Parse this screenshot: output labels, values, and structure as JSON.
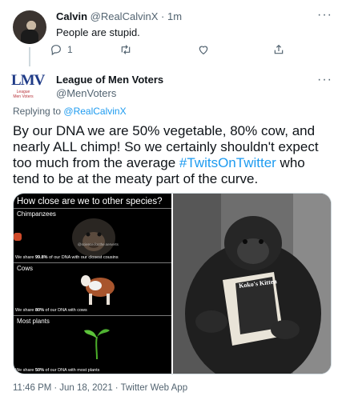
{
  "reply_tweet": {
    "name": "Calvin",
    "handle": "@RealCalvinX",
    "separator": "·",
    "time": "1m",
    "text": "People are stupid.",
    "more": "···",
    "reply_count": "1",
    "retweet_count": "",
    "like_count": ""
  },
  "main_tweet": {
    "avatar_logo": "LMV",
    "avatar_subtitle_line1": "League",
    "avatar_subtitle_line2": "Men Voters",
    "name": "League of Men Voters",
    "handle": "@MenVoters",
    "more": "···",
    "replying_prefix": "Replying to",
    "replying_handle": "@RealCalvinX",
    "text_before": "By our DNA we are 50% vegetable, 80% cow, and nearly ALL chimp!  So we certainly shouldn't expect too much from the average ",
    "hashtag": "#TwitsOnTwitter",
    "text_after": " who tend to be at the meaty part of the curve.",
    "infographic": {
      "title": "How close are we to other species?",
      "panels": [
        {
          "label": "Chimpanzees",
          "caption_pre": "We share ",
          "caption_bold": "99.8%",
          "caption_post": " of our DNA with our closest cousins",
          "watermark": "@science.for.the.serverts"
        },
        {
          "label": "Cows",
          "caption_pre": "We share ",
          "caption_bold": "80%",
          "caption_post": " of our DNA with cows"
        },
        {
          "label": "Most plants",
          "caption_pre": "We share ",
          "caption_bold": "50%",
          "caption_post": " of our DNA with most plants"
        }
      ]
    },
    "photo_book_title": "Koko's Kitten",
    "time": "11:46 PM",
    "date": "Jun 18, 2021",
    "source": "Twitter Web App",
    "separator": "·"
  },
  "colors": {
    "accent": "#1d9bf0",
    "text": "#0f1419",
    "secondary": "#536471",
    "border": "#cfd9de"
  }
}
